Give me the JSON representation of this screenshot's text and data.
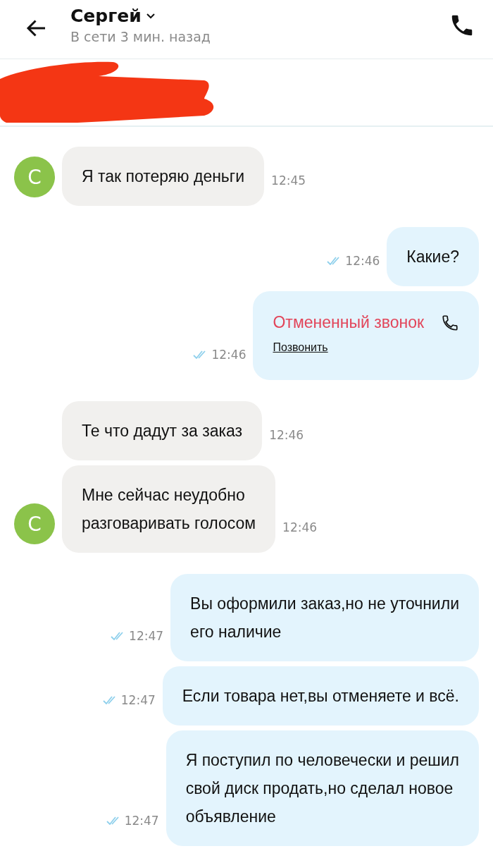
{
  "header": {
    "name": "Сергей",
    "status": "В сети 3 мин. назад"
  },
  "listing": {
    "redacted": true
  },
  "messages": [
    {
      "kind": "incoming",
      "text": "Я так потеряю деньги",
      "time": "12:45",
      "avatar": "С"
    },
    {
      "kind": "outgoing",
      "text": "Какие?",
      "time": "12:46",
      "read": true
    },
    {
      "kind": "call",
      "text": "Отмененный звонок",
      "action": "Позвонить",
      "time": "12:46",
      "read": true
    },
    {
      "kind": "incoming",
      "text": "Те что дадут за заказ",
      "time": "12:46"
    },
    {
      "kind": "incoming",
      "text": "Мне сейчас неудобно\nразговаривать голосом",
      "time": "12:46",
      "avatar": "С"
    },
    {
      "kind": "outgoing",
      "text": "Вы оформили заказ,но не уточнили\nего наличие",
      "time": "12:47",
      "read": true
    },
    {
      "kind": "outgoing",
      "text": "Если товара нет,вы отменяете и всё.",
      "time": "12:47",
      "read": true
    },
    {
      "kind": "outgoing",
      "text": "Я поступил по человечески и решил\nсвой диск продать,но сделал новое\nобъявление",
      "time": "12:47",
      "read": true
    }
  ]
}
